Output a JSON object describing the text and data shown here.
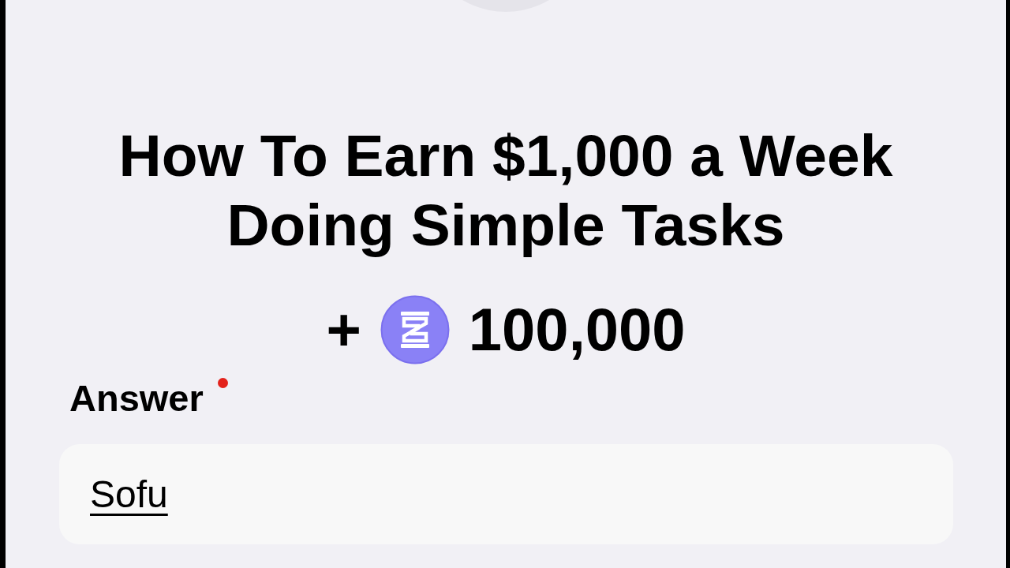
{
  "title": "How To Earn $1,000 a Week Doing Simple Tasks",
  "reward": {
    "sign": "+",
    "amount": "100,000"
  },
  "answer": {
    "label": "Answer",
    "required": true,
    "value": "Sofu",
    "composing": true
  }
}
